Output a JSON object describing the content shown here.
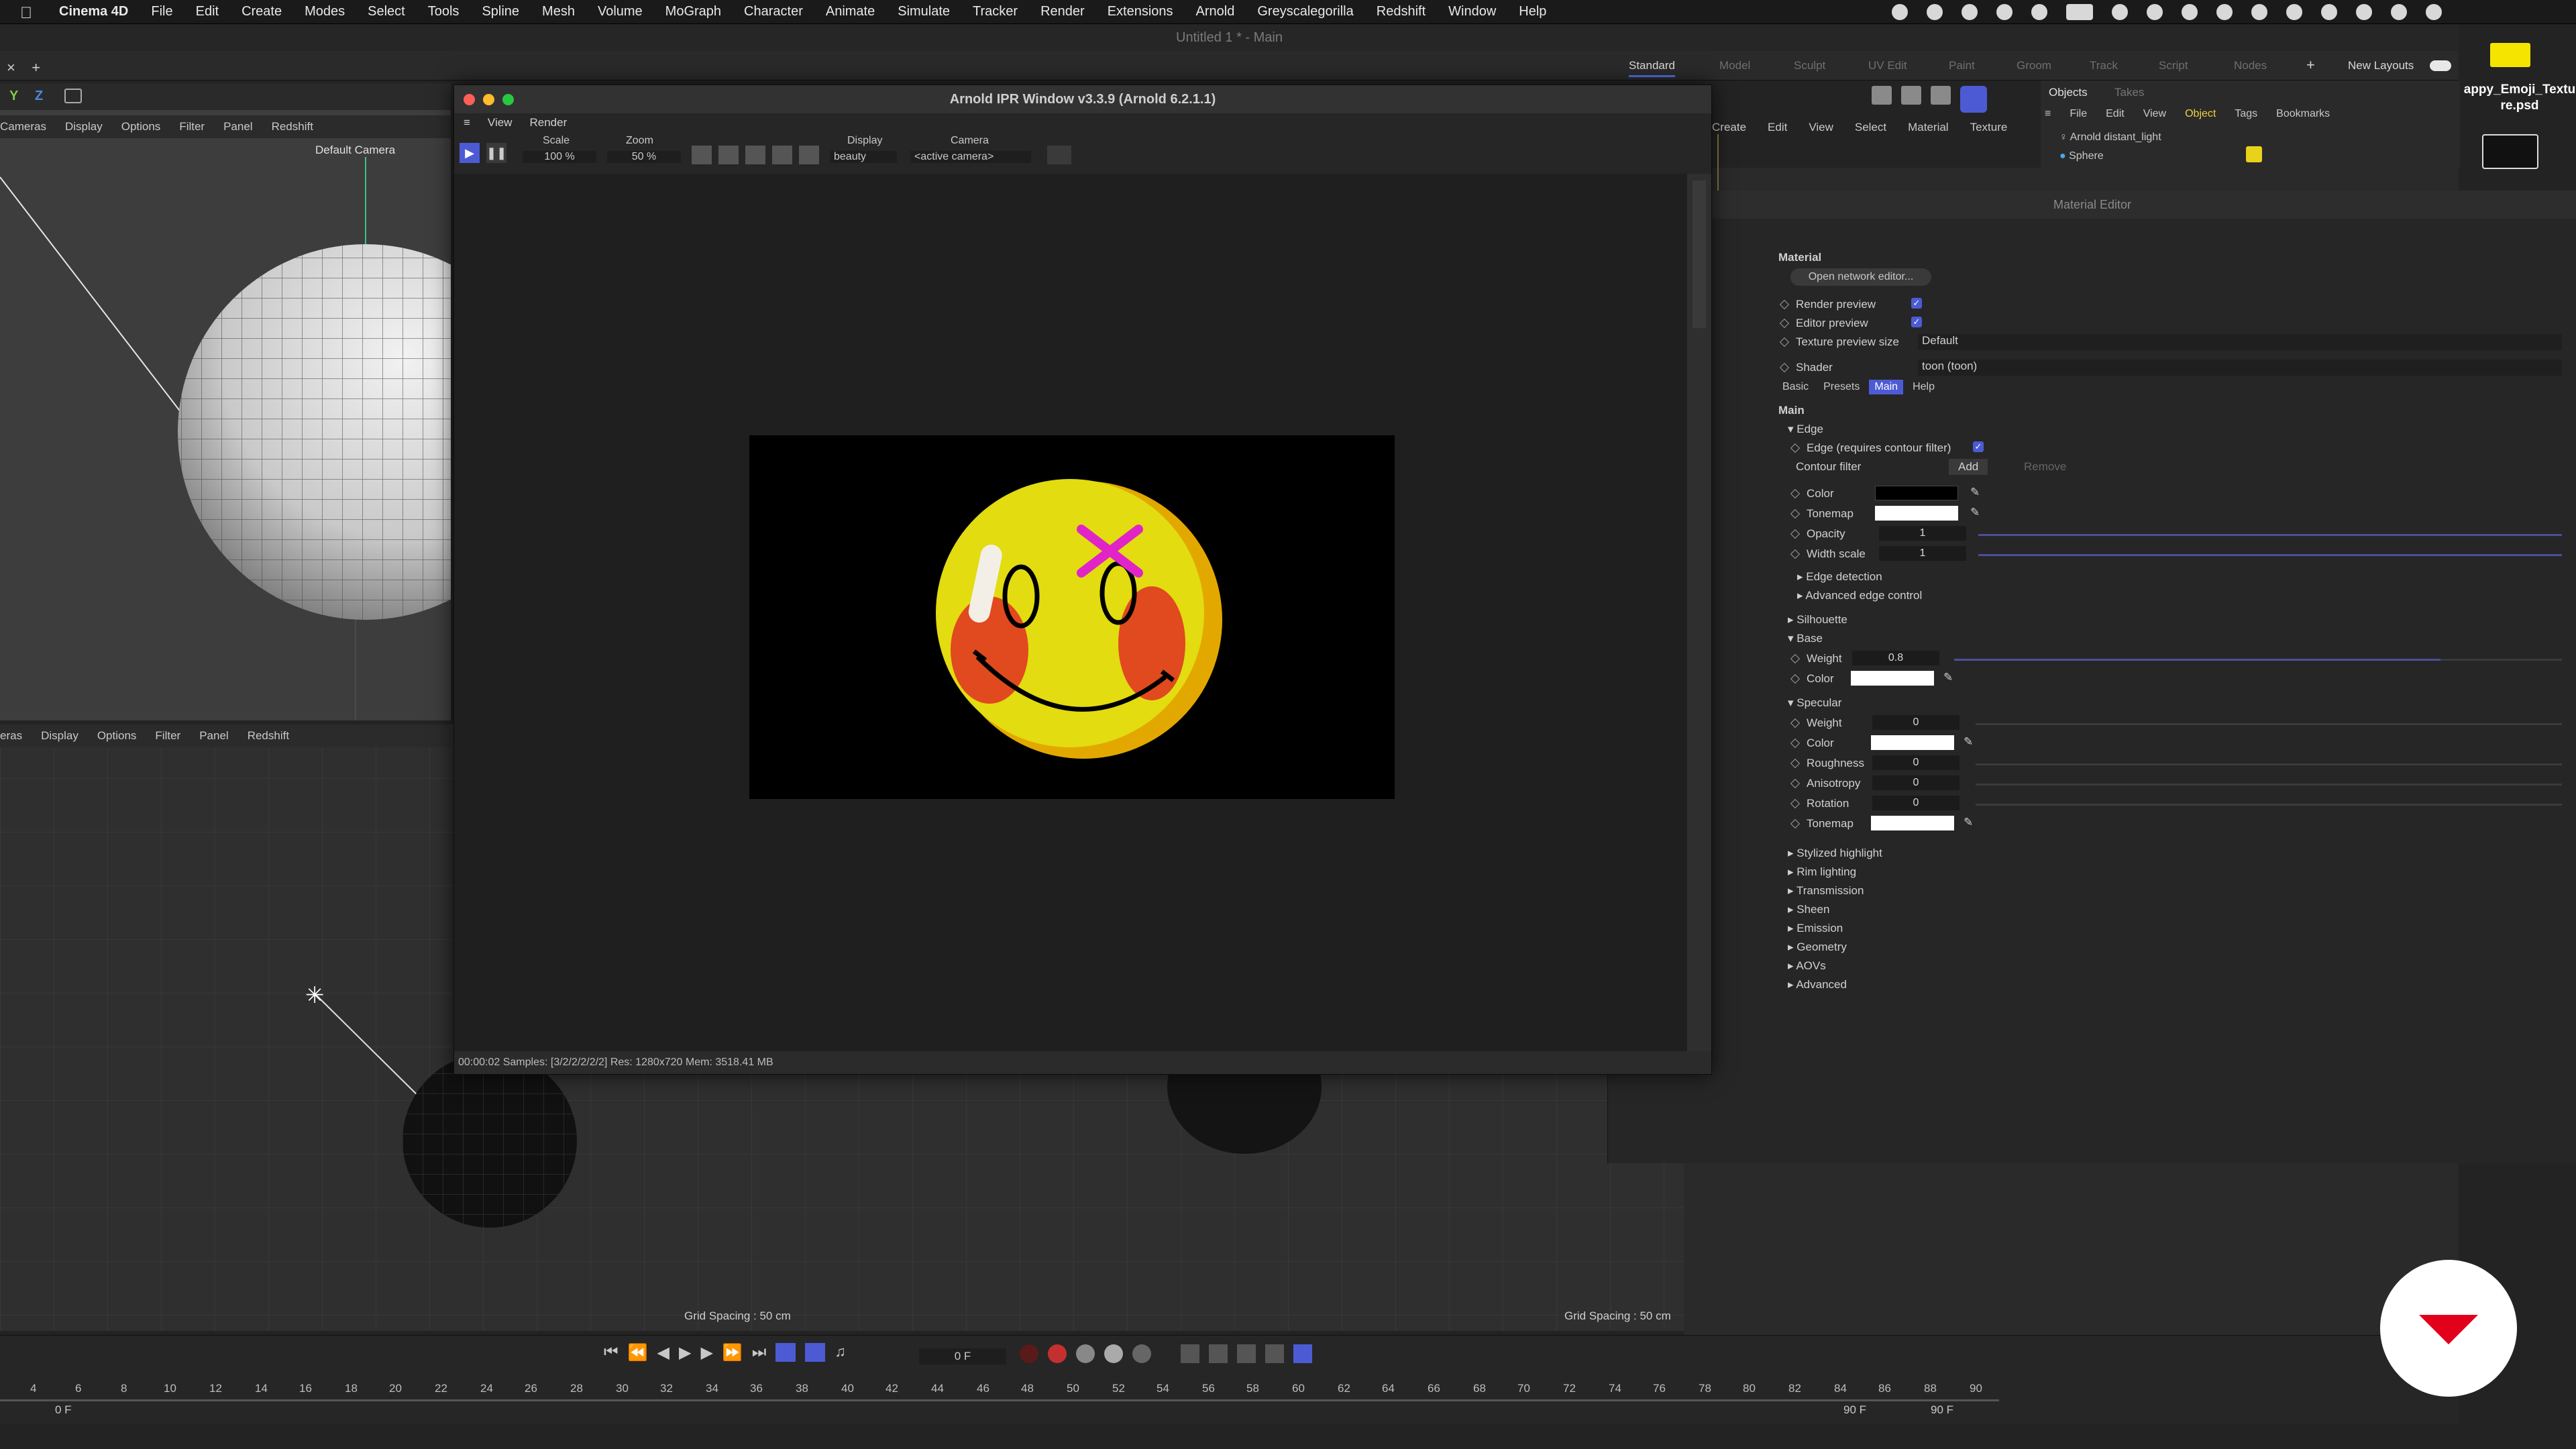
{
  "menubar": {
    "app": "Cinema 4D",
    "items": [
      "File",
      "Edit",
      "Create",
      "Modes",
      "Select",
      "Tools",
      "Spline",
      "Mesh",
      "Volume",
      "MoGraph",
      "Character",
      "Animate",
      "Simulate",
      "Tracker",
      "Render",
      "Extensions",
      "Arnold",
      "Greyscalegorilla",
      "Redshift",
      "Window",
      "Help"
    ]
  },
  "document_title": "Untitled 1 * - Main",
  "layouts": {
    "tabs": [
      "Standard",
      "Model",
      "Sculpt",
      "UV Edit",
      "Paint",
      "Groom",
      "Track",
      "Script",
      "Nodes"
    ],
    "active": "Standard",
    "new_layouts": "New Layouts"
  },
  "desktop_file": {
    "label": "appy_Emoji_Texture.psd"
  },
  "viewport_top": {
    "menu": [
      "Cameras",
      "Display",
      "Options",
      "Filter",
      "Panel",
      "Redshift"
    ],
    "camera": "Default Camera",
    "axes": [
      "Y",
      "Z"
    ]
  },
  "viewport_bottom": {
    "menu": [
      "eras",
      "Display",
      "Options",
      "Filter",
      "Panel",
      "Redshift"
    ],
    "grid_spacing": "Grid Spacing : 50 cm"
  },
  "viewport_right": {
    "grid_spacing": "Grid Spacing : 50 cm"
  },
  "ipr": {
    "title": "Arnold IPR Window v3.3.9 (Arnold 6.2.1.1)",
    "menu": [
      "View",
      "Render"
    ],
    "scale_label": "Scale",
    "scale_value": "100 %",
    "zoom_label": "Zoom",
    "zoom_value": "50 %",
    "display_label": "Display",
    "display_value": "beauty",
    "camera_label": "Camera",
    "camera_value": "<active camera>",
    "status": "00:00:02  Samples: [3/2/2/2/2/2]  Res: 1280x720  Mem: 3518.41 MB"
  },
  "objects_panel": {
    "tabs": [
      "Objects",
      "Takes"
    ],
    "menu": [
      "File",
      "Edit",
      "View",
      "Object",
      "Tags",
      "Bookmarks"
    ],
    "items": [
      "Arnold distant_light",
      "Sphere"
    ]
  },
  "toolbar_right": {
    "menu": [
      "Create",
      "Edit",
      "View",
      "Select",
      "Material",
      "Texture"
    ]
  },
  "material_editor": {
    "title": "Material Editor",
    "section": "Material",
    "open_network": "Open network editor...",
    "render_preview": "Render preview",
    "editor_preview": "Editor preview",
    "texture_preview_size": "Texture preview size",
    "texture_preview_value": "Default",
    "shader_label": "Shader",
    "shader_value": "toon (toon)",
    "tabs": [
      "Basic",
      "Presets",
      "Main",
      "Help"
    ],
    "active_tab": "Main",
    "main_title": "Main",
    "edge_title": "Edge",
    "edge_requires": "Edge (requires contour filter)",
    "contour_filter": "Contour filter",
    "add": "Add",
    "remove": "Remove",
    "color": "Color",
    "tonemap": "Tonemap",
    "opacity": "Opacity",
    "opacity_value": "1",
    "width_scale": "Width scale",
    "width_scale_value": "1",
    "edge_detection": "Edge detection",
    "advanced_edge": "Advanced edge control",
    "silhouette": "Silhouette",
    "base": "Base",
    "weight": "Weight",
    "base_weight_value": "0.8",
    "specular": "Specular",
    "spec_weight_value": "0",
    "roughness": "Roughness",
    "roughness_value": "0",
    "anisotropy": "Anisotropy",
    "anisotropy_value": "0",
    "rotation": "Rotation",
    "rotation_value": "0",
    "collapsed": [
      "Stylized highlight",
      "Rim lighting",
      "Transmission",
      "Sheen",
      "Emission",
      "Geometry",
      "AOVs",
      "Advanced"
    ]
  },
  "timeline": {
    "frame": "0 F",
    "start": "0 F",
    "end1": "90 F",
    "end2": "90 F",
    "ticks": [
      "4",
      "6",
      "8",
      "10",
      "12",
      "14",
      "16",
      "18",
      "20",
      "22",
      "24",
      "26",
      "28",
      "30",
      "32",
      "34",
      "36",
      "38",
      "40",
      "42",
      "44",
      "46",
      "48",
      "50",
      "52",
      "54",
      "56",
      "58",
      "60",
      "62",
      "64",
      "66",
      "68",
      "70",
      "72",
      "74",
      "76",
      "78",
      "80",
      "82",
      "84",
      "86",
      "88",
      "90"
    ]
  },
  "colors": {
    "accent": "#4c5bd4",
    "emoji_yellow": "#e2dc10",
    "emoji_cheek": "#e04a1e",
    "x_mark": "#e024c8",
    "badge_red": "#e3001b"
  }
}
